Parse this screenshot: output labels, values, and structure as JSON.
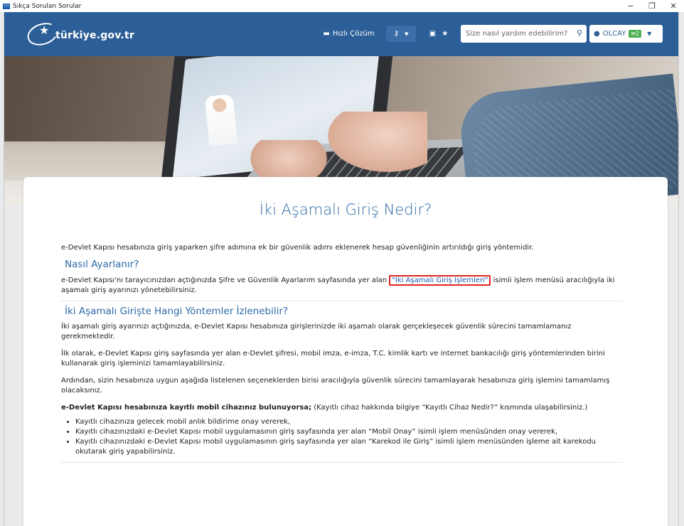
{
  "window": {
    "title": "Sıkça Sorulan Sorular",
    "controls": [
      "−",
      "❐",
      "✕"
    ]
  },
  "header": {
    "logo_text": "türkiye.gov.tr",
    "quick_solution_label": "Hızlı Çözüm",
    "search_placeholder": "Size nasıl yardım edebilirim?",
    "user_name": "OLCAY",
    "message_count": "2",
    "colors": {
      "header_bg": "#2c5f97",
      "accent": "#2e6aa6"
    }
  },
  "article": {
    "title": "İki Aşamalı Giriş Nedir?",
    "intro": "e-Devlet Kapısı hesabınıza giriş yaparken şifre adımına ek bir güvenlik adımı eklenerek hesap güvenliğinin artırıldığı giriş yöntemidir.",
    "section1_heading": "Nasıl Ayarlanır?",
    "section1_text_before": "e-Devlet Kapısı'nı tarayıcınızdan açtığınızda Şifre ve Güvenlik Ayarlarım sayfasında yer alan ",
    "section1_link": "\"İki Aşamalı Giriş İşlemleri\"",
    "section1_text_after": " isimli işlem menüsü aracılığıyla iki aşamalı giriş ayarınızı yönetebilirsiniz.",
    "section2_heading": "İki Aşamalı Girişte Hangi Yöntemler İzlenebilir?",
    "section2_p1": "İki aşamalı giriş ayarınızı açtığınızda, e-Devlet Kapısı hesabınıza girişlerinizde iki aşamalı olarak gerçekleşecek güvenlik sürecini tamamlamanız gerekmektedir.",
    "section2_p2": "İlk olarak, e-Devlet Kapısı giriş sayfasında yer alan e-Devlet şifresi, mobil imza, e-imza, T.C. kimlik kartı ve internet bankacılığı giriş yöntemlerinden birini kullanarak giriş işleminizi tamamlayabilirsiniz.",
    "section2_p3": "Ardından, sizin hesabınıza uygun aşağıda listelenen seçeneklerden birisi aracılığıyla güvenlik sürecini tamamlayarak hesabınıza giriş işlemini tamamlamış olacaksınız.",
    "section2_p4_bold": "e-Devlet Kapısı hesabınıza kayıtlı mobil cihazınız bulunuyorsa;",
    "section2_p4_rest": " (Kayıtlı cihaz hakkında bilgiye “Kayıtlı Cihaz Nedir?” kısmında ulaşabilirsiniz.)",
    "bullets": [
      "Kayıtlı cihazınıza gelecek mobil anlık bildirime onay vererek,",
      "Kayıtlı cihazınızdaki e-Devlet Kapısı mobil uygulamasının giriş sayfasında yer alan “Mobil Onay” isimli işlem menüsünden onay vererek,",
      "Kayıtlı cihazınızdaki e-Devlet Kapısı mobil uygulamasının giriş sayfasında yer alan “Karekod ile Giriş” isimli işlem menüsünden işleme ait karekodu okutarak giriş yapabilirsiniz."
    ]
  }
}
